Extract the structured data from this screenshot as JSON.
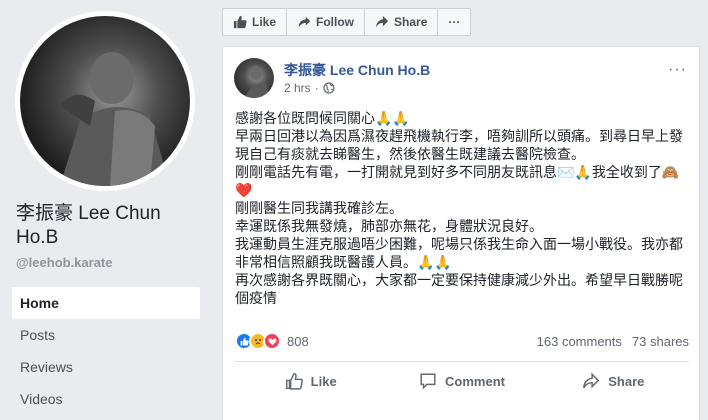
{
  "profile": {
    "name": "李振豪 Lee Chun Ho.B",
    "handle": "@leehob.karate"
  },
  "nav": {
    "items": [
      {
        "label": "Home",
        "active": true
      },
      {
        "label": "Posts",
        "active": false
      },
      {
        "label": "Reviews",
        "active": false
      },
      {
        "label": "Videos",
        "active": false
      }
    ]
  },
  "actions": {
    "like": "Like",
    "follow": "Follow",
    "share": "Share",
    "more": "···"
  },
  "post": {
    "author": "李振豪 Lee Chun Ho.B",
    "time": "2 hrs",
    "separator": "·",
    "audience_icon": "globe-icon",
    "more": "···",
    "lines": [
      "感謝各位既問候同關心🙏🙏",
      "早兩日回港以為因爲濕夜趕飛機執行李，唔夠訓所以頭痛。到尋日早上發",
      "現自己有痰就去睇醫生，然後依醫生既建議去醫院檢查。",
      "剛剛電話先有電，一打開就見到好多不同朋友既訊息✉️🙏我全收到了🙈",
      "❤️",
      "剛剛醫生同我講我確診左。",
      "幸運既係我無發燒，肺部亦無花，身體狀況良好。",
      "我運動員生涯克服過唔少困難，呢場只係我生命入面一場小戰役。我亦都",
      "非常相信照顧我既醫護人員。🙏🙏",
      "再次感謝各界既關心，大家都一定要保持健康減少外出。希望早日戰勝呢",
      "個疫情"
    ],
    "reaction_count": "808",
    "comments": "163 comments",
    "shares": "73 shares",
    "like": "Like",
    "comment": "Comment",
    "share": "Share"
  },
  "colors": {
    "link": "#365899",
    "like_blue": "#1877f2",
    "love_red": "#f33e58",
    "care_yellow": "#f7b928"
  }
}
